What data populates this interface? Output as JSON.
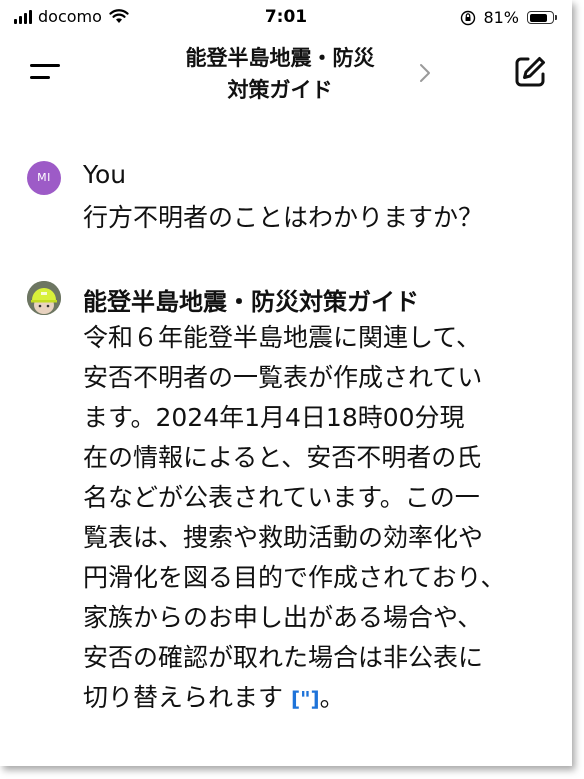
{
  "status_bar": {
    "carrier": "docomo",
    "time": "7:01",
    "battery_percent": "81%",
    "battery_level": 0.81
  },
  "header": {
    "title_line1": "能登半島地震・防災",
    "title_line2": "対策ガイド"
  },
  "messages": [
    {
      "role": "user",
      "avatar_initials": "MI",
      "author": "You",
      "text": "行方不明者のことはわかりますか？"
    },
    {
      "role": "assistant",
      "author": "能登半島地震・防災対策ガイド",
      "lines": [
        "令和６年能登半島地震に関連して、",
        "安否不明者の一覧表が作成されてい",
        "ます。2024年1月4日18時00分現",
        "在の情報によると、安否不明者の氏",
        "名などが公表されています。この一",
        "覧表は、捜索や救助活動の効率化や",
        "円滑化を図る目的で作成されており、",
        "家族からのお申し出がある場合や、",
        "安否の確認が取れた場合は非公表に",
        "切り替えられます"
      ],
      "citation_glyph": "[\"]",
      "trailing_punct": "。"
    }
  ],
  "colors": {
    "user_avatar": "#9d5bc7",
    "citation": "#1e73d9"
  }
}
